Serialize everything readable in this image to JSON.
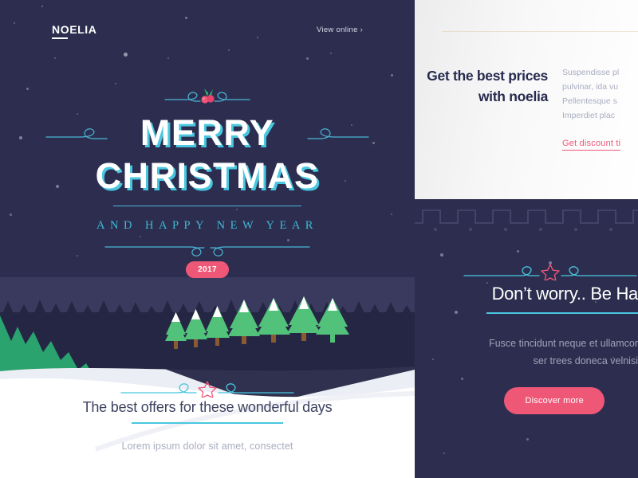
{
  "brand": {
    "logo": "NOELIA",
    "view_online": "View online",
    "chevron": "›"
  },
  "hero": {
    "ornament_icon": "holly-berry-icon",
    "title_line1": "MERRY",
    "title_line2": "CHRISTMAS",
    "subtitle": "AND HAPPY NEW YEAR",
    "year_badge": "2017"
  },
  "offers": {
    "ornament_icon": "star-flourish-icon",
    "title": "The best offers for these wonderful days",
    "subtitle": "Lorem ipsum dolor sit amet, consectet"
  },
  "prices_card": {
    "heading_line1": "Get the best prices",
    "heading_line2": "with noelia",
    "body_lines": [
      "Suspendisse pl",
      "pulvinar, ida vu",
      "Pellentesque s",
      "Imperdiet plac"
    ],
    "link": "Get discount ti"
  },
  "dark_card": {
    "ornament_icon": "star-flourish-icon",
    "title": "Don’t worry.. Be Ha",
    "body_line1": "Fusce tincidunt neque et ullamcor",
    "body_line2": "ser trees doneca velnisi",
    "button": "Discover more"
  },
  "colors": {
    "night": "#2d2e4f",
    "cyan": "#49c7e0",
    "pink": "#ef5777",
    "forest_green": "#2aa36e",
    "tree_green": "#52c27a",
    "snow": "#ffffff",
    "muted_text": "#a9adc0",
    "dark_text": "#262a4d"
  }
}
